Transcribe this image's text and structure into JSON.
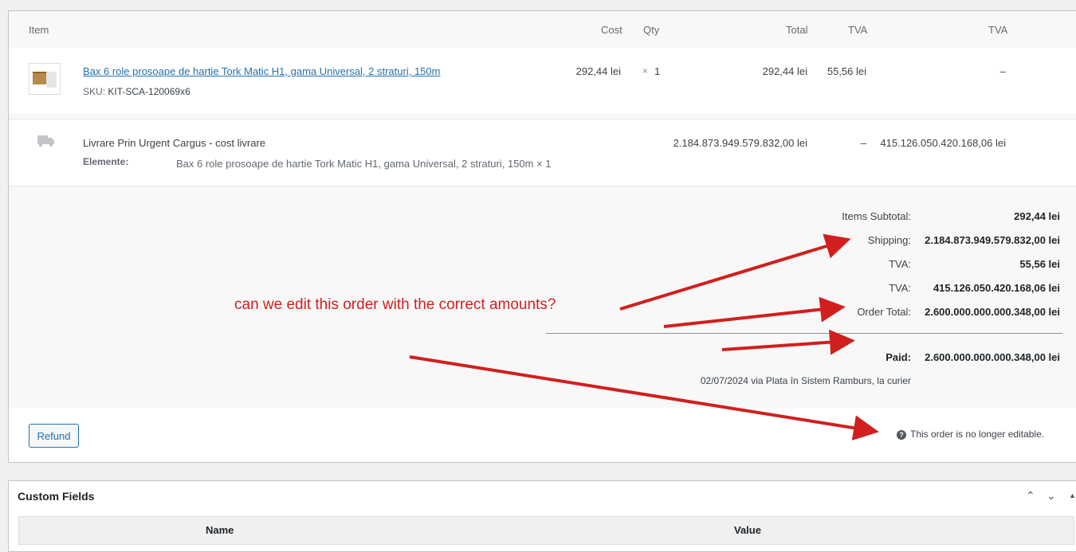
{
  "table": {
    "headers": {
      "item": "Item",
      "cost": "Cost",
      "qty": "Qty",
      "total": "Total",
      "tva1": "TVA",
      "tva2": "TVA"
    },
    "product": {
      "name": "Bax 6 role prosoape de hartie Tork Matic H1, gama Universal, 2 straturi, 150m",
      "sku_label": "SKU:",
      "sku": "KIT-SCA-120069x6",
      "cost": "292,44 lei",
      "qty_symbol": "×",
      "qty": "1",
      "total": "292,44 lei",
      "tva1": "55,56 lei",
      "tva2": "–"
    },
    "shipping": {
      "name": "Livrare Prin Urgent Cargus - cost livrare",
      "items_label": "Elemente:",
      "items_value": "Bax 6 role prosoape de hartie Tork Matic H1, gama Universal, 2 straturi, 150m × 1",
      "total": "2.184.873.949.579.832,00 lei",
      "tva1": "–",
      "tva2": "415.126.050.420.168,06 lei"
    }
  },
  "totals": {
    "items_subtotal_label": "Items Subtotal:",
    "items_subtotal": "292,44 lei",
    "shipping_label": "Shipping:",
    "shipping": "2.184.873.949.579.832,00 lei",
    "tva1_label": "TVA:",
    "tva1": "55,56 lei",
    "tva2_label": "TVA:",
    "tva2": "415.126.050.420.168,06 lei",
    "order_total_label": "Order Total:",
    "order_total": "2.600.000.000.000.348,00 lei",
    "paid_label": "Paid:",
    "paid": "2.600.000.000.000.348,00 lei",
    "paid_note": "02/07/2024 via Plata în Sistem Ramburs, la curier"
  },
  "footer": {
    "refund_label": "Refund",
    "help_glyph": "?",
    "not_editable": "This order is no longer editable."
  },
  "annotation": {
    "text": "can we edit this order with the correct amounts?",
    "color": "#d11f1f"
  },
  "custom_fields": {
    "title": "Custom Fields",
    "col_name": "Name",
    "col_value": "Value",
    "up_glyph": "⌃",
    "down_glyph": "⌄",
    "toggle_glyph": "▲"
  },
  "colors": {
    "link": "#2271b1",
    "accent": "#2271b1",
    "annotation": "#d11f1f"
  }
}
